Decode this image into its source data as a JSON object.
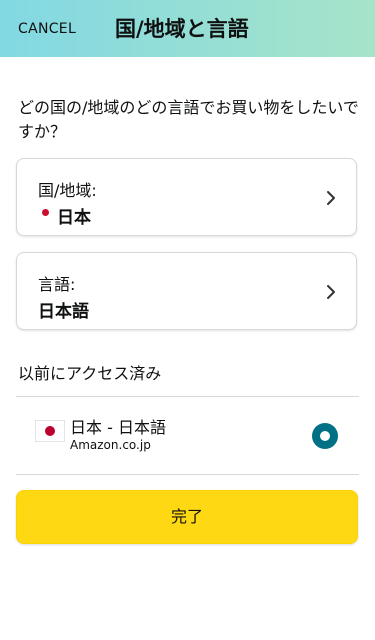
{
  "header": {
    "cancel_label": "CANCEL",
    "title": "国/地域と言語",
    "gradient_start": "#82d8e3",
    "gradient_end": "#a6e4c9"
  },
  "question": "どの国の/地域のどの言語でお買い物をしたいですか？",
  "country_card": {
    "label": "国/地域:",
    "value": "日本",
    "icon": "chevron-right-icon"
  },
  "language_card": {
    "label": "言語:",
    "value": "日本語",
    "icon": "chevron-right-icon"
  },
  "recent": {
    "heading": "以前にアクセス済み",
    "items": [
      {
        "title": "日本 - 日本語",
        "site": "Amazon.co.jp",
        "flag_icon": "japan-flag-icon",
        "selected": true
      }
    ]
  },
  "done_button": {
    "label": "完了",
    "color": "#ffd814"
  },
  "colors": {
    "radio_selected": "#007185",
    "country_dot": "#c8102e"
  }
}
